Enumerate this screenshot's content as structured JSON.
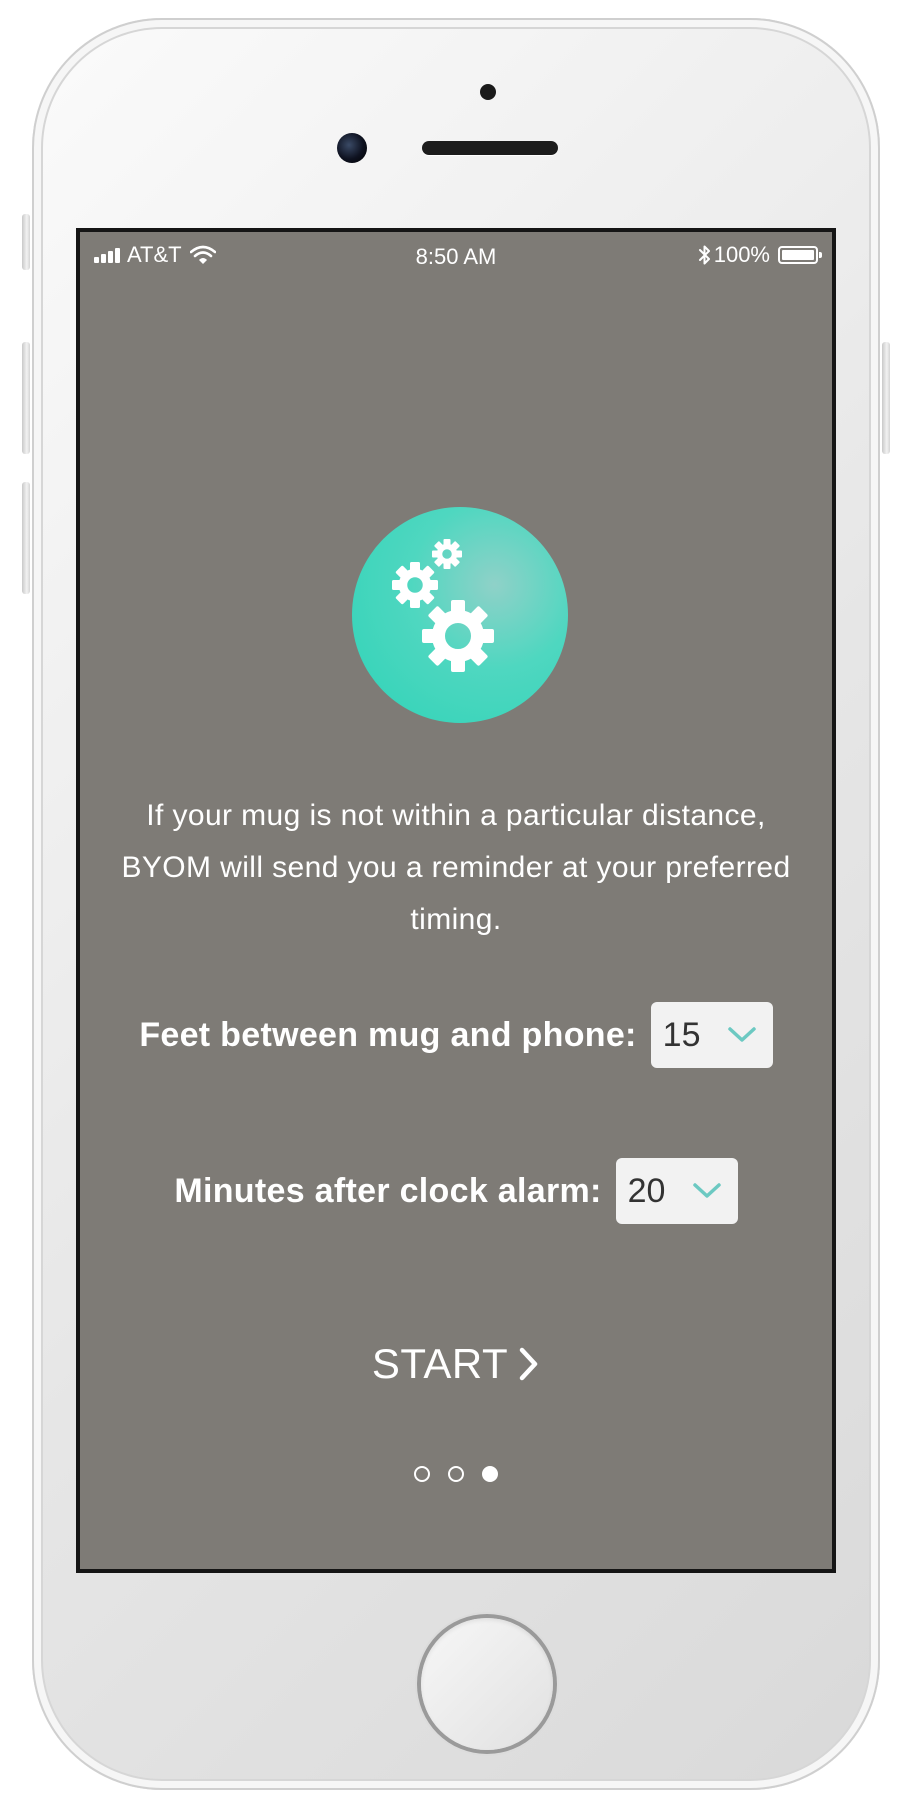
{
  "status_bar": {
    "carrier": "AT&T",
    "time": "8:50 AM",
    "battery": "100%",
    "icons": [
      "signal-icon",
      "wifi-icon",
      "bluetooth-icon",
      "battery-icon"
    ]
  },
  "hero": {
    "icon": "gears-icon",
    "badge_color": "#2ed3b7"
  },
  "description": "If your mug is not within a particular distance, BYOM will send you a reminder at your preferred timing.",
  "settings": {
    "feet": {
      "label": "Feet between mug and phone:",
      "value": "15"
    },
    "minutes": {
      "label": "Minutes after clock alarm:",
      "value": "20"
    }
  },
  "start_label": "START",
  "pagination": {
    "total": 3,
    "current": 3
  },
  "colors": {
    "screen_background": "#7e7b76",
    "accent": "#2ed3b7",
    "chevron": "#6cc9c2"
  }
}
